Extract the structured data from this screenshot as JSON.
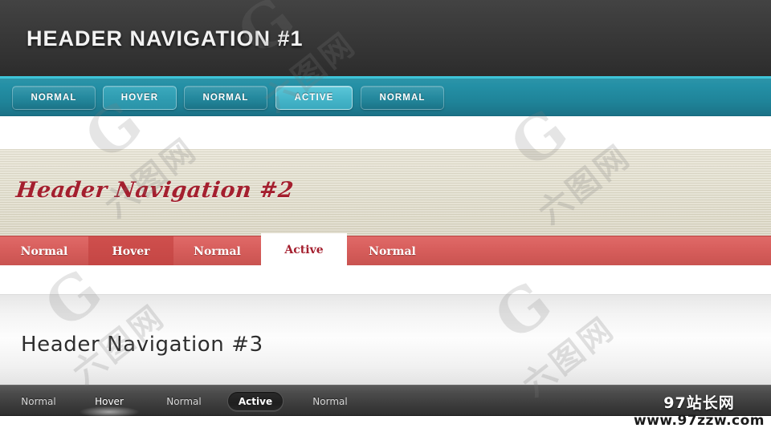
{
  "sections": [
    {
      "id": "section-1",
      "title": "HEADER NAVIGATION #1",
      "theme_colors": {
        "header_bg": "#3b3b3b",
        "nav_bg": "#1f8499",
        "nav_top_border": "#3ec4d8",
        "active": "#45b5c9"
      },
      "nav_items": [
        {
          "label": "NORMAL",
          "state": "normal"
        },
        {
          "label": "HOVER",
          "state": "hover"
        },
        {
          "label": "NORMAL",
          "state": "normal"
        },
        {
          "label": "ACTIVE",
          "state": "active"
        },
        {
          "label": "NORMAL",
          "state": "normal"
        }
      ]
    },
    {
      "id": "section-2",
      "title": "Header Navigation #2",
      "theme_colors": {
        "header_bg": "#ddd9c6",
        "title": "#a41f2e",
        "nav_bg": "#d75e5c",
        "active_bg": "#ffffff"
      },
      "nav_items": [
        {
          "label": "Normal",
          "state": "normal"
        },
        {
          "label": "Hover",
          "state": "hover"
        },
        {
          "label": "Normal",
          "state": "normal"
        },
        {
          "label": "Active",
          "state": "active"
        },
        {
          "label": "Normal",
          "state": "normal"
        }
      ]
    },
    {
      "id": "section-3",
      "title": "Header Navigation #3",
      "theme_colors": {
        "header_bg": "#f4f4f4",
        "title": "#2e2e2e",
        "nav_bg": "#3a3a3a",
        "active_bg": "#1f1f1f"
      },
      "nav_items": [
        {
          "label": "Normal",
          "state": "normal"
        },
        {
          "label": "Hover",
          "state": "hover"
        },
        {
          "label": "Normal",
          "state": "normal"
        },
        {
          "label": "Active",
          "state": "active"
        },
        {
          "label": "Normal",
          "state": "normal"
        }
      ]
    }
  ],
  "watermarks": {
    "diagonal_text": "六图网",
    "logo_glyph": "G",
    "footer_line1": "97站长网",
    "footer_line2": "www.97zzw.com"
  }
}
